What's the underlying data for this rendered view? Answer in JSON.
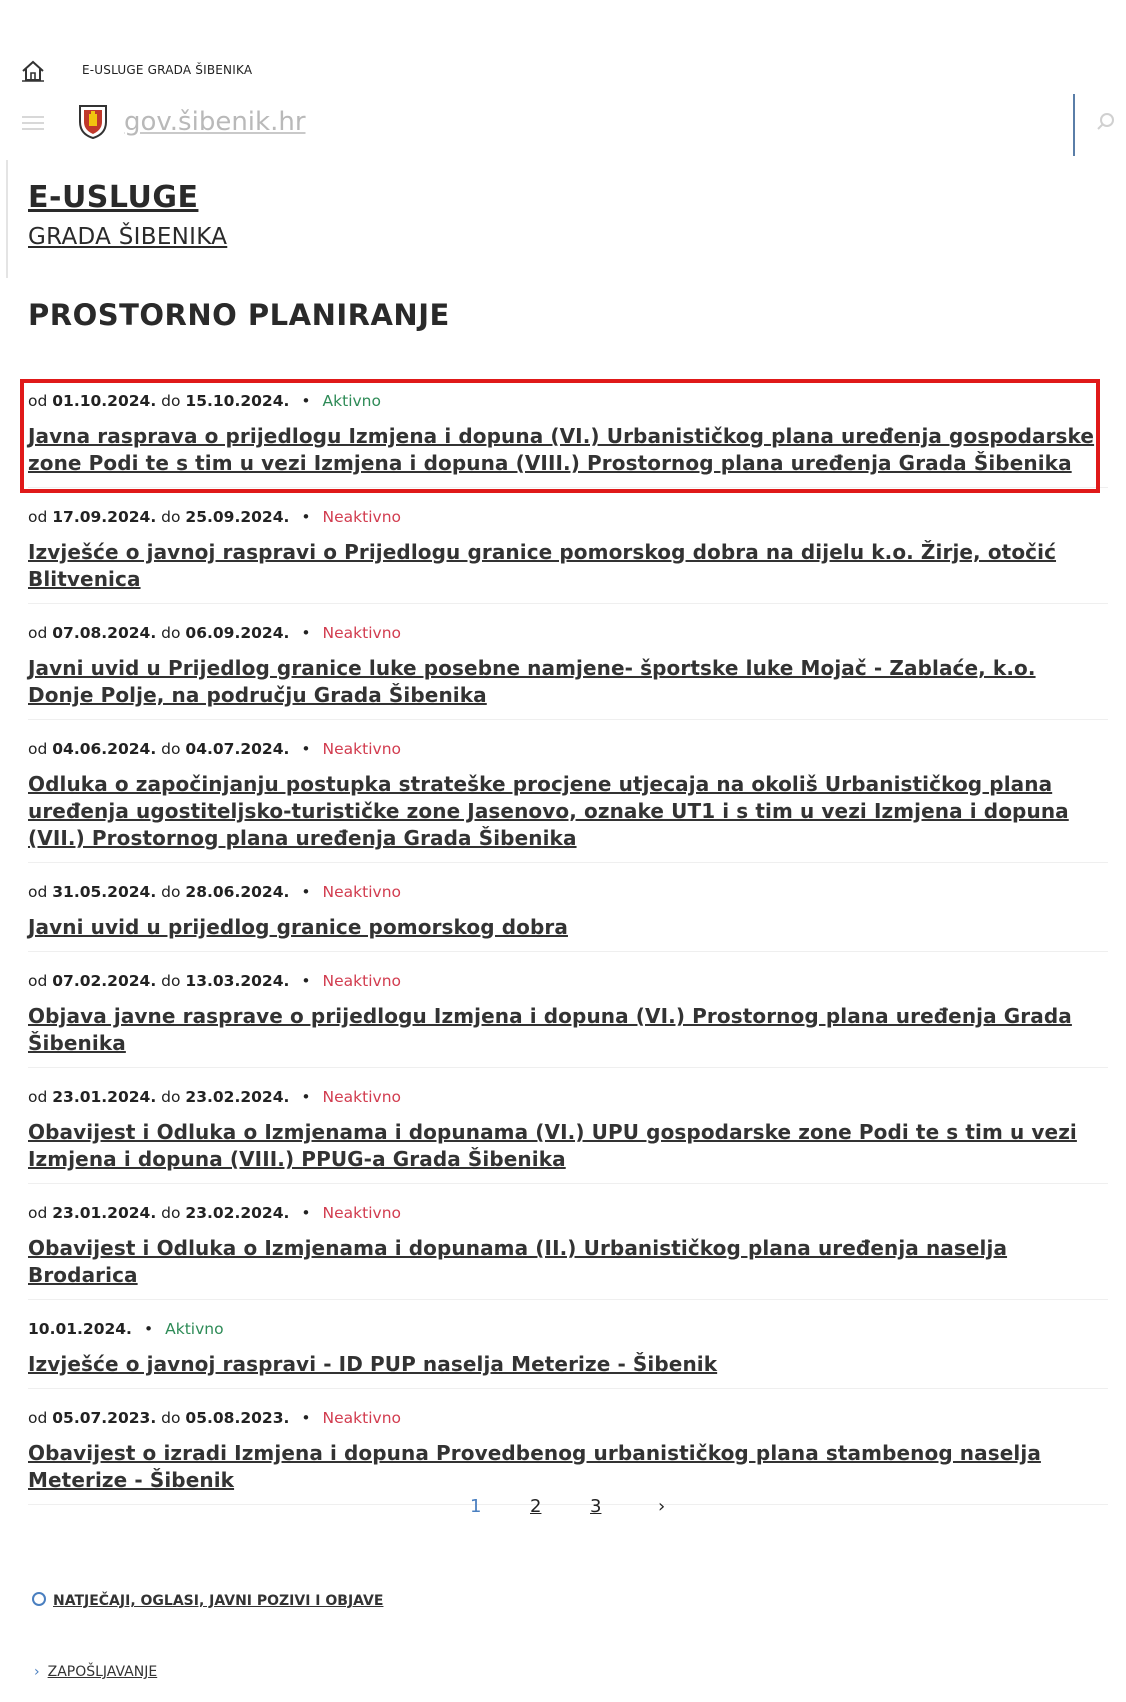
{
  "header": {
    "title": "E-USLUGE GRADA ŠIBENIKA",
    "domain": "gov.šibenik.hr"
  },
  "brand": {
    "line1": "E-USLUGE",
    "line2": "GRADA ŠIBENIKA"
  },
  "page": {
    "title": "PROSTORNO PLANIRANJE"
  },
  "entries": [
    {
      "from_prefix": "od",
      "from": "01.10.2024.",
      "to_prefix": "do",
      "to": "15.10.2024.",
      "status": "Aktivno",
      "title": "Javna rasprava o prijedlogu Izmjena i dopuna (VI.) Urbanističkog plana uređenja gospodarske zone Podi te s tim u vezi Izmjena i dopuna (VIII.) Prostornog plana uređenja Grada Šibenika"
    },
    {
      "from_prefix": "od",
      "from": "17.09.2024.",
      "to_prefix": "do",
      "to": "25.09.2024.",
      "status": "Neaktivno",
      "title": "Izvješće o javnoj raspravi o Prijedlogu granice pomorskog dobra na dijelu k.o. Žirje, otočić Blitvenica"
    },
    {
      "from_prefix": "od",
      "from": "07.08.2024.",
      "to_prefix": "do",
      "to": "06.09.2024.",
      "status": "Neaktivno",
      "title": "Javni uvid u Prijedlog granice luke posebne namjene- športske luke Mojač - Zablaće, k.o. Donje Polje, na području Grada Šibenika"
    },
    {
      "from_prefix": "od",
      "from": "04.06.2024.",
      "to_prefix": "do",
      "to": "04.07.2024.",
      "status": "Neaktivno",
      "title": "Odluka o započinjanju postupka strateške procjene utjecaja na okoliš Urbanističkog plana uređenja ugostiteljsko-turističke zone Jasenovo, oznake UT1 i s tim u vezi Izmjena i dopuna (VII.) Prostornog plana uređenja Grada Šibenika"
    },
    {
      "from_prefix": "od",
      "from": "31.05.2024.",
      "to_prefix": "do",
      "to": "28.06.2024.",
      "status": "Neaktivno",
      "title": "Javni uvid u prijedlog granice pomorskog dobra"
    },
    {
      "from_prefix": "od",
      "from": "07.02.2024.",
      "to_prefix": "do",
      "to": "13.03.2024.",
      "status": "Neaktivno",
      "title": "Objava javne rasprave o prijedlogu Izmjena i dopuna (VI.) Prostornog plana uređenja Grada Šibenika"
    },
    {
      "from_prefix": "od",
      "from": "23.01.2024.",
      "to_prefix": "do",
      "to": "23.02.2024.",
      "status": "Neaktivno",
      "title": "Obavijest i Odluka o Izmjenama i dopunama (VI.) UPU gospodarske zone Podi te s tim u vezi Izmjena i dopuna (VIII.) PPUG-a Grada Šibenika"
    },
    {
      "from_prefix": "od",
      "from": "23.01.2024.",
      "to_prefix": "do",
      "to": "23.02.2024.",
      "status": "Neaktivno",
      "title": "Obavijest i Odluka o Izmjenama i dopunama (II.) Urbanističkog plana uređenja naselja Brodarica"
    },
    {
      "from_prefix": "",
      "from": "10.01.2024.",
      "to_prefix": "",
      "to": "",
      "status": "Aktivno",
      "title": "Izvješće o javnoj raspravi - ID PUP naselja Meterize - Šibenik"
    },
    {
      "from_prefix": "od",
      "from": "05.07.2023.",
      "to_prefix": "do",
      "to": "05.08.2023.",
      "status": "Neaktivno",
      "title": "Obavijest o izradi Izmjena i dopuna Provedbenog urbanističkog plana stambenog naselja Meterize - Šibenik"
    }
  ],
  "pagination": {
    "pages": [
      "1",
      "2",
      "3"
    ],
    "next": "›"
  },
  "footer": {
    "link1": "NATJEČAJI, OGLASI, JAVNI POZIVI I OBJAVE",
    "link2": "ZAPOŠLJAVANJE"
  },
  "icons": {
    "home": "home-icon",
    "menu": "menu-icon",
    "crest": "crest-icon",
    "search": "search-icon"
  },
  "colors": {
    "active": "#2e8b57",
    "inactive": "#d23c4f",
    "highlight_box": "#e01919",
    "accent_blue": "#4a7fc0"
  }
}
